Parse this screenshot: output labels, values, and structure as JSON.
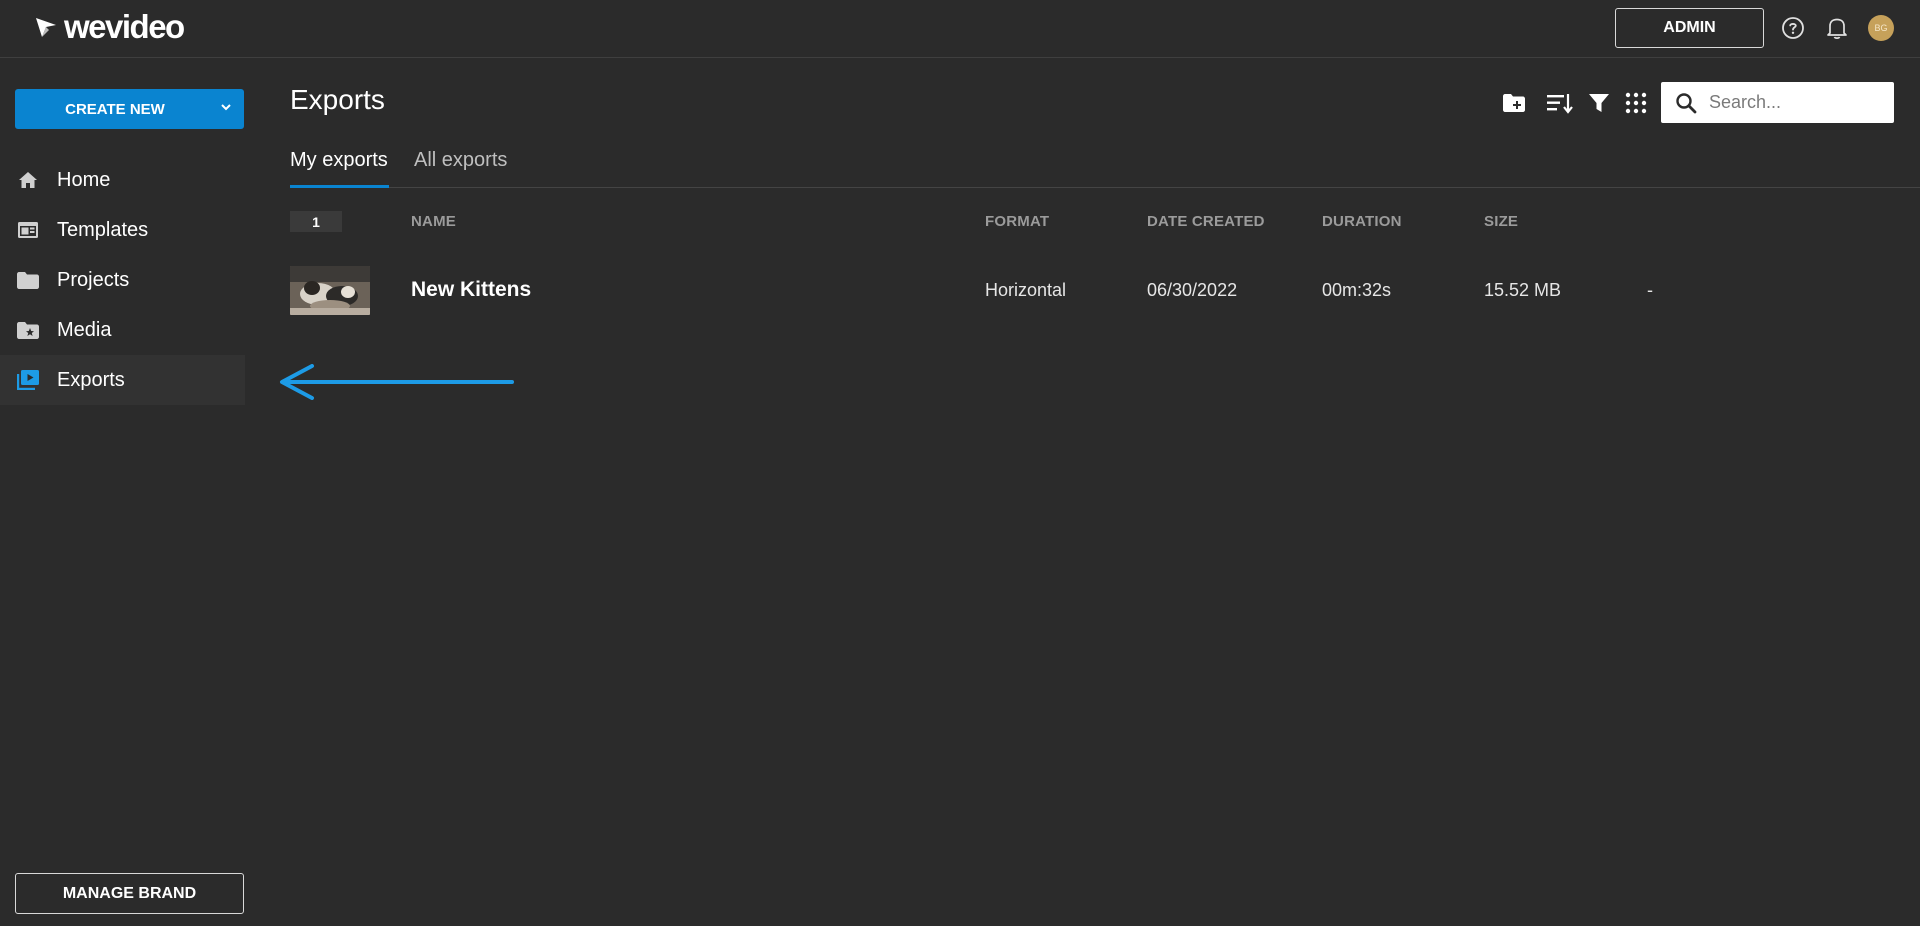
{
  "app": {
    "logo_text": "wevideo",
    "admin_label": "ADMIN",
    "avatar_initials": "BG",
    "brand_color": "#0a84d0"
  },
  "sidebar": {
    "create_new_label": "CREATE NEW",
    "items": [
      {
        "label": "Home",
        "icon": "home-icon"
      },
      {
        "label": "Templates",
        "icon": "templates-icon"
      },
      {
        "label": "Projects",
        "icon": "folder-icon"
      },
      {
        "label": "Media",
        "icon": "media-folder-icon"
      },
      {
        "label": "Exports",
        "icon": "exports-icon",
        "active": true
      }
    ],
    "manage_brand_label": "MANAGE BRAND"
  },
  "main": {
    "title": "Exports",
    "search_placeholder": "Search...",
    "tabs": [
      {
        "label": "My exports",
        "active": true
      },
      {
        "label": "All exports",
        "active": false
      }
    ],
    "count": "1",
    "columns": {
      "name": "NAME",
      "format": "FORMAT",
      "date_created": "DATE CREATED",
      "duration": "DURATION",
      "size": "SIZE"
    },
    "rows": [
      {
        "name": "New Kittens",
        "format": "Horizontal",
        "date_created": "06/30/2022",
        "duration": "00m:32s",
        "size": "15.52 MB",
        "extra": "-"
      }
    ]
  }
}
